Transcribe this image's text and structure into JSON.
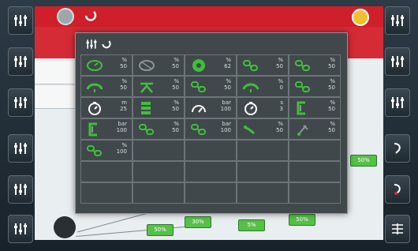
{
  "background": {
    "pills": [
      "50%",
      "50%",
      "30%",
      "5%",
      "50%"
    ]
  },
  "popup": {
    "cells": [
      {
        "icon": "ecu-speed-icon",
        "unit": "%",
        "value": "50"
      },
      {
        "icon": "ecu-off-icon",
        "unit": "%",
        "value": "50"
      },
      {
        "icon": "target-icon",
        "unit": "%",
        "value": "62"
      },
      {
        "icon": "chain-icon",
        "unit": "%",
        "value": "50"
      },
      {
        "icon": "chain-icon",
        "unit": "%",
        "value": "50"
      },
      {
        "icon": "hood-icon",
        "unit": "%",
        "value": "50"
      },
      {
        "icon": "tripod-icon",
        "unit": "%",
        "value": "50"
      },
      {
        "icon": "chain-icon",
        "unit": "%",
        "value": "50"
      },
      {
        "icon": "hood-icon",
        "unit": "%",
        "value": "0"
      },
      {
        "icon": "chain-icon",
        "unit": "%",
        "value": "50"
      },
      {
        "icon": "timer-icon",
        "unit": "m",
        "value": "25"
      },
      {
        "icon": "stack-icon",
        "unit": "%",
        "value": "50"
      },
      {
        "icon": "gauge-icon",
        "unit": "bar",
        "value": "100"
      },
      {
        "icon": "timer-icon",
        "unit": "s",
        "value": "3"
      },
      {
        "icon": "bracket-icon",
        "unit": "%",
        "value": "50"
      },
      {
        "icon": "bracket-icon",
        "unit": "bar",
        "value": "100"
      },
      {
        "icon": "chain-icon",
        "unit": "%",
        "value": "50"
      },
      {
        "icon": "chain-icon",
        "unit": "bar",
        "value": "100"
      },
      {
        "icon": "link-icon",
        "unit": "%",
        "value": "50"
      },
      {
        "icon": "tool-icon",
        "unit": "%",
        "value": "50"
      },
      {
        "icon": "chain-icon",
        "unit": "%",
        "value": "100"
      },
      {
        "icon": "",
        "unit": "",
        "value": ""
      },
      {
        "icon": "",
        "unit": "",
        "value": ""
      },
      {
        "icon": "",
        "unit": "",
        "value": ""
      },
      {
        "icon": "",
        "unit": "",
        "value": ""
      },
      {
        "icon": "",
        "unit": "",
        "value": ""
      },
      {
        "icon": "",
        "unit": "",
        "value": ""
      },
      {
        "icon": "",
        "unit": "",
        "value": ""
      },
      {
        "icon": "",
        "unit": "",
        "value": ""
      },
      {
        "icon": "",
        "unit": "",
        "value": ""
      },
      {
        "icon": "",
        "unit": "",
        "value": ""
      },
      {
        "icon": "",
        "unit": "",
        "value": ""
      },
      {
        "icon": "",
        "unit": "",
        "value": ""
      },
      {
        "icon": "",
        "unit": "",
        "value": ""
      },
      {
        "icon": "",
        "unit": "",
        "value": ""
      }
    ]
  },
  "colors": {
    "accent": "#cf1f2a",
    "icon_green": "#3fbf3a",
    "panel": "#41484c"
  }
}
